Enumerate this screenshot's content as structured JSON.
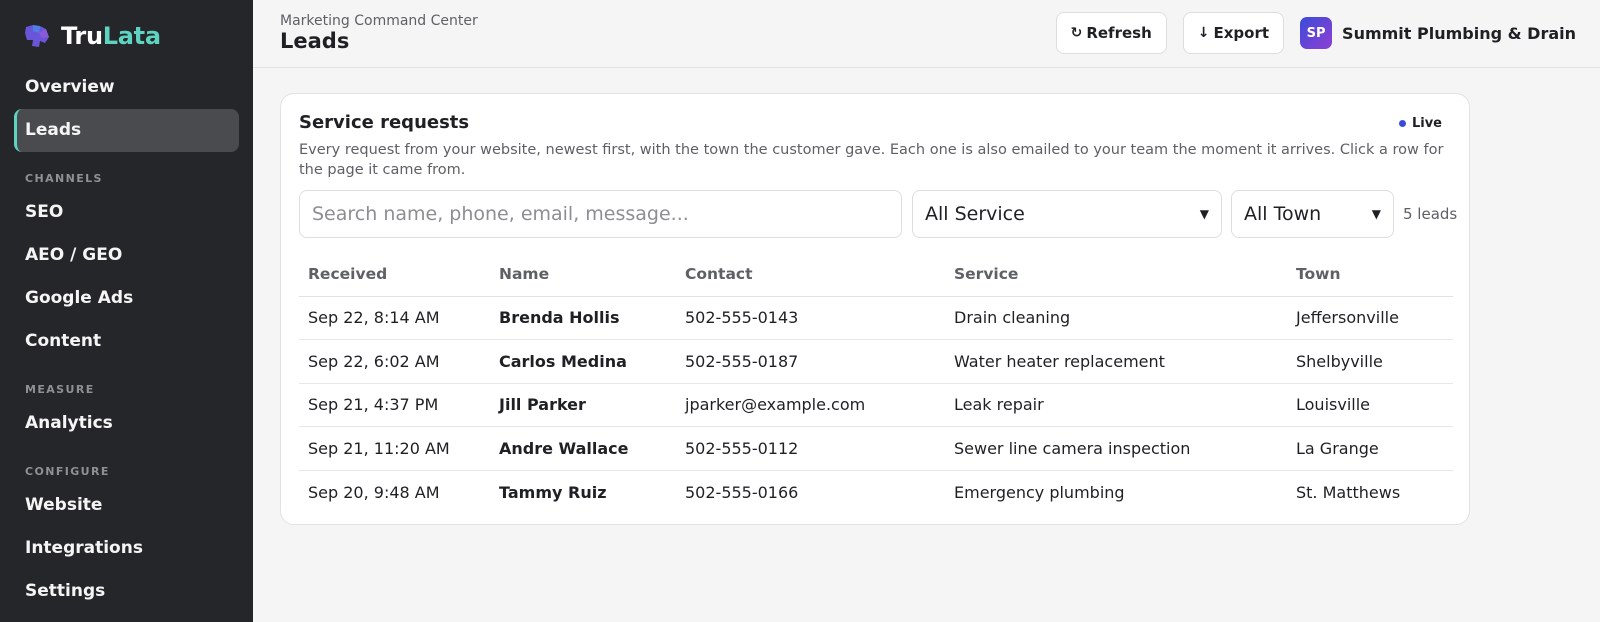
{
  "brand": {
    "part1": "Tru",
    "part2": "Lata"
  },
  "sidebar": {
    "top": [
      {
        "label": "Overview"
      },
      {
        "label": "Leads",
        "active": true
      }
    ],
    "channels_label": "CHANNELS",
    "channels": [
      {
        "label": "SEO"
      },
      {
        "label": "AEO / GEO"
      },
      {
        "label": "Google Ads"
      },
      {
        "label": "Content"
      }
    ],
    "measure_label": "MEASURE",
    "measure": [
      {
        "label": "Analytics"
      }
    ],
    "configure_label": "CONFIGURE",
    "configure": [
      {
        "label": "Website"
      },
      {
        "label": "Integrations"
      },
      {
        "label": "Settings"
      }
    ]
  },
  "header": {
    "breadcrumb": "Marketing Command Center",
    "title": "Leads",
    "refresh_label": "Refresh",
    "export_label": "Export",
    "avatar_initials": "SP",
    "account_name": "Summit Plumbing & Drain"
  },
  "card": {
    "title": "Service requests",
    "live_label": "Live",
    "description": "Every request from your website, newest first, with the town the customer gave. Each one is also emailed to your team the moment it arrives. Click a row for the page it came from.",
    "search_placeholder": "Search name, phone, email, message...",
    "service_filter": "All Service",
    "town_filter": "All Town",
    "count": "5 leads"
  },
  "table": {
    "columns": [
      "Received",
      "Name",
      "Contact",
      "Service",
      "Town"
    ],
    "rows": [
      [
        "Sep 22, 8:14 AM",
        "Brenda Hollis",
        "502-555-0143",
        "Drain cleaning",
        "Jeffersonville"
      ],
      [
        "Sep 22, 6:02 AM",
        "Carlos Medina",
        "502-555-0187",
        "Water heater replacement",
        "Shelbyville"
      ],
      [
        "Sep 21, 4:37 PM",
        "Jill Parker",
        "jparker@example.com",
        "Leak repair",
        "Louisville"
      ],
      [
        "Sep 21, 11:20 AM",
        "Andre Wallace",
        "502-555-0112",
        "Sewer line camera inspection",
        "La Grange"
      ],
      [
        "Sep 20, 9:48 AM",
        "Tammy Ruiz",
        "502-555-0166",
        "Emergency plumbing",
        "St. Matthews"
      ]
    ]
  },
  "colors": {
    "accent": "#5ed3c1",
    "sidebar": "#252629",
    "live_dot": "#3b4bd8"
  },
  "icons": {
    "logo": "puzzle-logo-icon",
    "refresh": "refresh-icon",
    "export": "download-arrow-icon",
    "select": "chevron-down-icon"
  }
}
